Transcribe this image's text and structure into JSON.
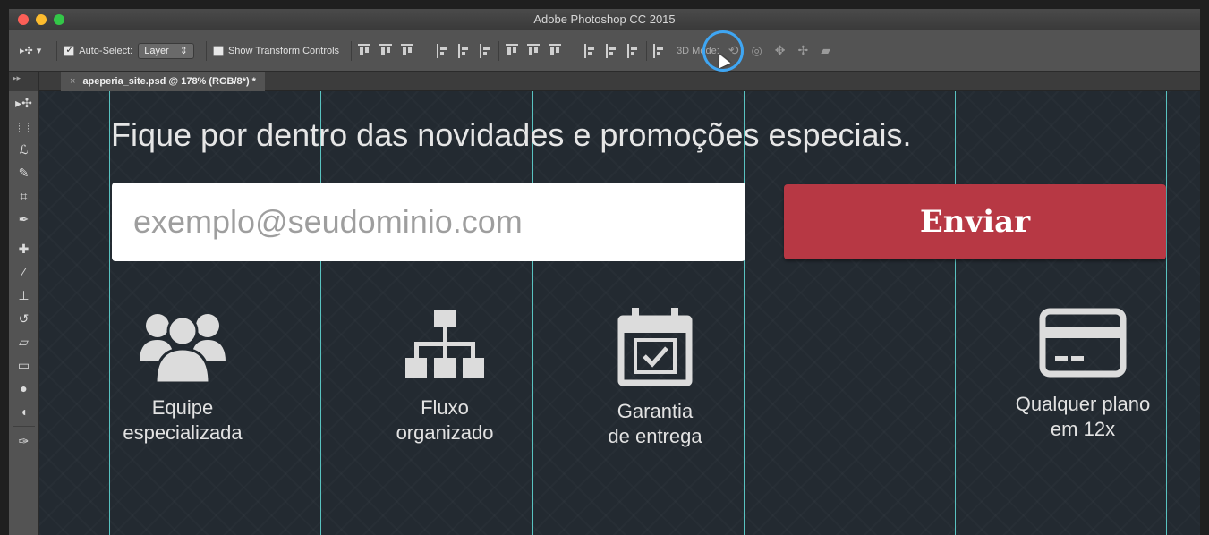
{
  "window": {
    "title": "Adobe Photoshop CC 2015"
  },
  "options_bar": {
    "auto_select_label": "Auto-Select:",
    "auto_select_value": "Layer",
    "show_transform_label": "Show Transform Controls",
    "mode_label": "3D Mode:"
  },
  "document_tab": {
    "title": "apeperia_site.psd @ 178% (RGB/8*) *",
    "close_glyph": "×"
  },
  "canvas": {
    "headline": "Fique por dentro das novidades e promoções especiais.",
    "email_placeholder": "exemplo@seudominio.com",
    "submit_label": "Enviar",
    "features": [
      {
        "icon": "team-icon",
        "line1": "Equipe",
        "line2": "especializada"
      },
      {
        "icon": "flowchart-icon",
        "line1": "Fluxo",
        "line2": "organizado"
      },
      {
        "icon": "calendar-check-icon",
        "line1": "Garantia",
        "line2": "de entrega"
      },
      {
        "icon": "credit-card-icon",
        "line1": "Qualquer plano",
        "line2": "em 12x"
      }
    ]
  },
  "colors": {
    "canvas_bg": "#232a31",
    "guide": "#5fd3d0",
    "button": "#b73844",
    "highlight": "#3fa6f3"
  }
}
